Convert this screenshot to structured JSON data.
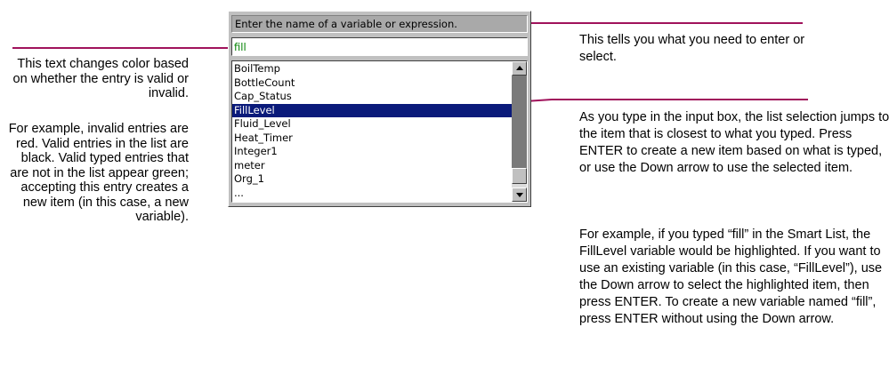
{
  "smart_list": {
    "prompt": "Enter the name of a variable or expression.",
    "entry_value": "fill",
    "entry_color": "#008000",
    "selected_bg": "#0a1a7a",
    "items": [
      "BoilTemp",
      "BottleCount",
      "Cap_Status",
      "FillLevel",
      "Fluid_Level",
      "Heat_Timer",
      "Integer1",
      "meter",
      "Org_1",
      "..."
    ],
    "selected_index": 3,
    "scroll_position": 0.85
  },
  "callout_color": "#a0125b",
  "left_notes": {
    "p1": "This text changes color based on whether the entry is valid or invalid.",
    "p2": "For example, invalid entries are red. Valid entries in the list are black. Valid typed entries that are not in the list appear green; accepting this entry creates a new item (in this case, a new variable)."
  },
  "right_notes": {
    "p1": "This tells you what you need to enter or select.",
    "p2": "As you type in the input box, the list selection jumps to the item that is closest to what you typed. Press ENTER to create a new item based on what is typed, or use the Down arrow to use the selected item.",
    "p3": "For example, if you typed “fill” in the Smart List, the FillLevel variable would be highlighted. If you want to use an existing variable (in this case, “FillLevel”), use the Down arrow to select the highlighted item, then press ENTER. To create a new variable named “fill”, press ENTER without using the Down arrow."
  }
}
